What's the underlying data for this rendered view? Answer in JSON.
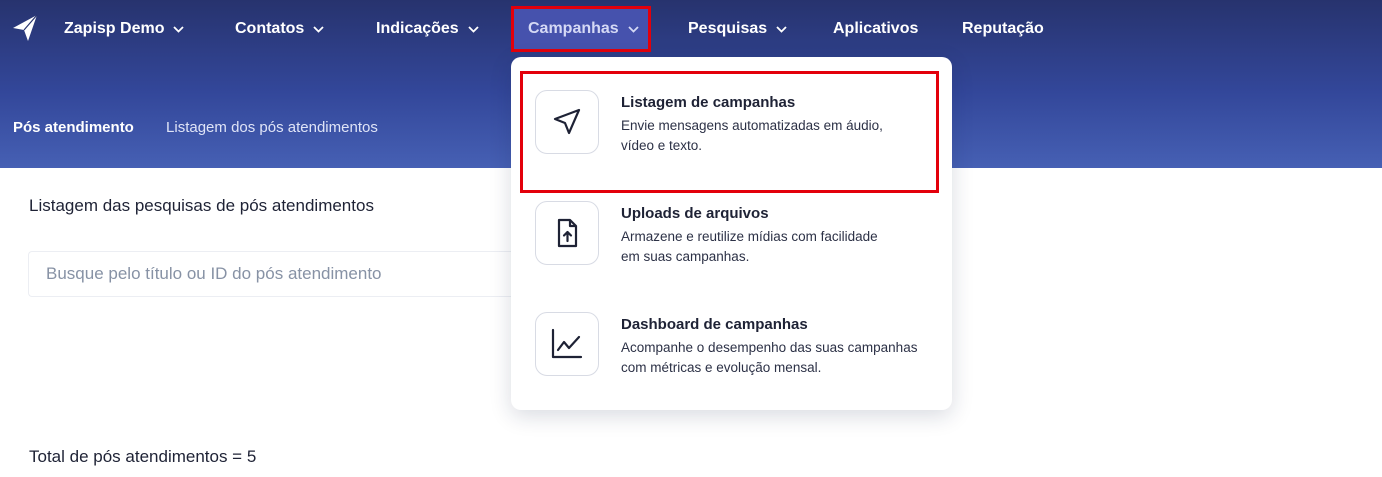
{
  "nav": {
    "items": [
      {
        "label": "Zapisp Demo",
        "has_chevron": true
      },
      {
        "label": "Contatos",
        "has_chevron": true
      },
      {
        "label": "Indicações",
        "has_chevron": true
      },
      {
        "label": "Campanhas",
        "has_chevron": true,
        "active": true
      },
      {
        "label": "Pesquisas",
        "has_chevron": true
      },
      {
        "label": "Aplicativos",
        "has_chevron": false
      },
      {
        "label": "Reputação",
        "has_chevron": false
      }
    ]
  },
  "breadcrumb": {
    "current": "Pós atendimento",
    "page": "Listagem dos pós atendimentos"
  },
  "main": {
    "section_title": "Listagem das pesquisas de pós atendimentos",
    "search_placeholder": "Busque pelo título ou ID do pós atendimento",
    "total_text": "Total de pós atendimentos = 5"
  },
  "dropdown": {
    "items": [
      {
        "icon": "send-icon",
        "title": "Listagem de campanhas",
        "desc_line1": "Envie mensagens automatizadas em áudio,",
        "desc_line2": "vídeo e texto."
      },
      {
        "icon": "file-upload-icon",
        "title": "Uploads de arquivos",
        "desc_line1": "Armazene e reutilize mídias com facilidade",
        "desc_line2": "em suas campanhas."
      },
      {
        "icon": "chart-line-icon",
        "title": "Dashboard de campanhas",
        "desc_line1": "Acompanhe o desempenho das suas campanhas",
        "desc_line2": "com métricas e evolução mensal."
      }
    ]
  },
  "colors": {
    "header_top": "#27336e",
    "header_bottom": "#4660b4",
    "active_tab": "#4652ad",
    "highlight_border": "#e3000b"
  }
}
